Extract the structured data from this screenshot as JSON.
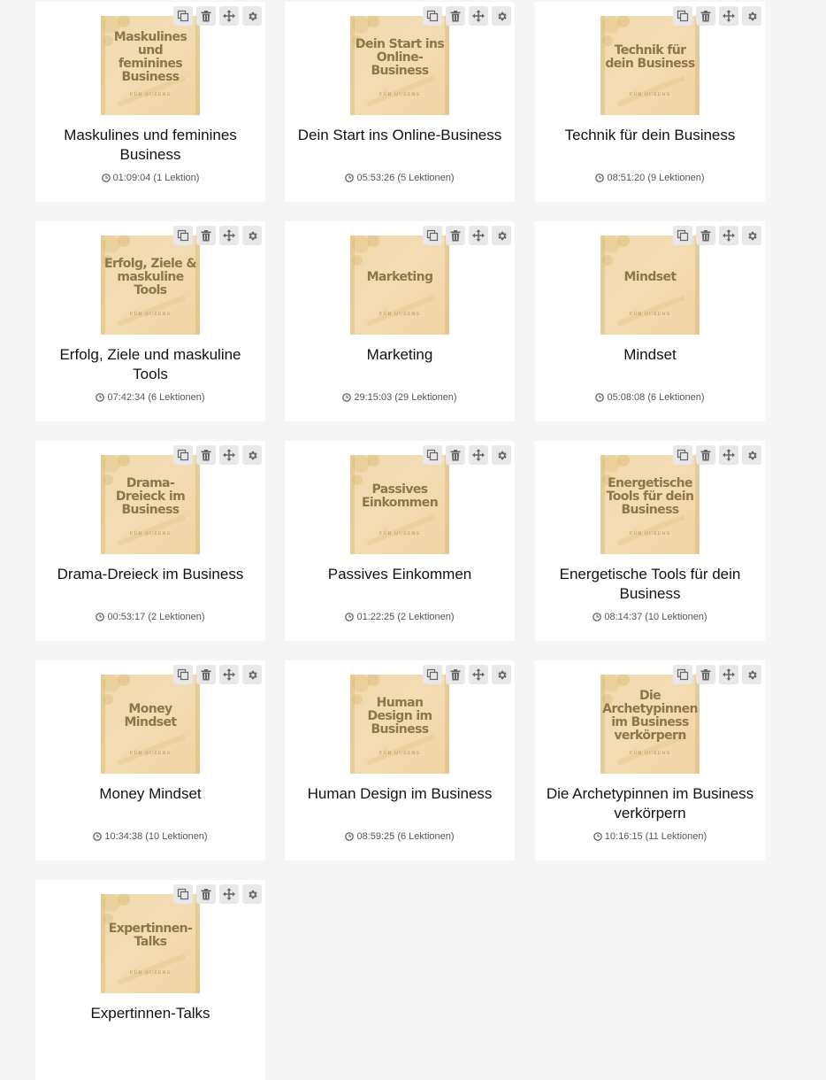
{
  "tool_labels": {
    "copy": "copy-icon",
    "delete": "trash-icon",
    "move": "move-icon",
    "settings": "gear-icon"
  },
  "cover_subtitle": "FÜR QUEENS",
  "courses": [
    {
      "title": "Maskulines und feminines Business",
      "cover": "Maskulines und feminines Business",
      "meta": "01:09:04 (1 Lektion)"
    },
    {
      "title": "Dein Start ins Online-Business",
      "cover": "Dein Start ins Online-Business",
      "meta": "05:53:26 (5 Lektionen)"
    },
    {
      "title": "Technik für dein Business",
      "cover": "Technik für dein Business",
      "meta": "08:51:20 (9 Lektionen)"
    },
    {
      "title": "Erfolg, Ziele und maskuline Tools",
      "cover": "Erfolg, Ziele & maskuline Tools",
      "meta": "07:42:34 (6 Lektionen)"
    },
    {
      "title": "Marketing",
      "cover": "Marketing",
      "meta": "29:15:03 (29 Lektionen)"
    },
    {
      "title": "Mindset",
      "cover": "Mindset",
      "meta": "05:08:08 (6 Lektionen)"
    },
    {
      "title": "Drama-Dreieck im Business",
      "cover": "Drama-Dreieck im Business",
      "meta": "00:53:17 (2 Lektionen)"
    },
    {
      "title": "Passives Einkommen",
      "cover": "Passives Einkommen",
      "meta": "01:22:25 (2 Lektionen)"
    },
    {
      "title": "Energetische Tools für dein Business",
      "cover": "Energetische Tools für dein Business",
      "meta": "08:14:37 (10 Lektionen)"
    },
    {
      "title": "Money Mindset",
      "cover": "Money Mindset",
      "meta": "10:34:38 (10 Lektionen)"
    },
    {
      "title": "Human Design im Business",
      "cover": "Human Design im Business",
      "meta": "08:59:25 (6 Lektionen)"
    },
    {
      "title": "Die Archetypinnen im Business verkörpern",
      "cover": "Die Archetypinnen im Business verkörpern",
      "meta": "10:16:15 (11 Lektionen)"
    },
    {
      "title": "Expertinnen-Talks",
      "cover": "Expertinnen-Talks",
      "meta": ""
    }
  ]
}
